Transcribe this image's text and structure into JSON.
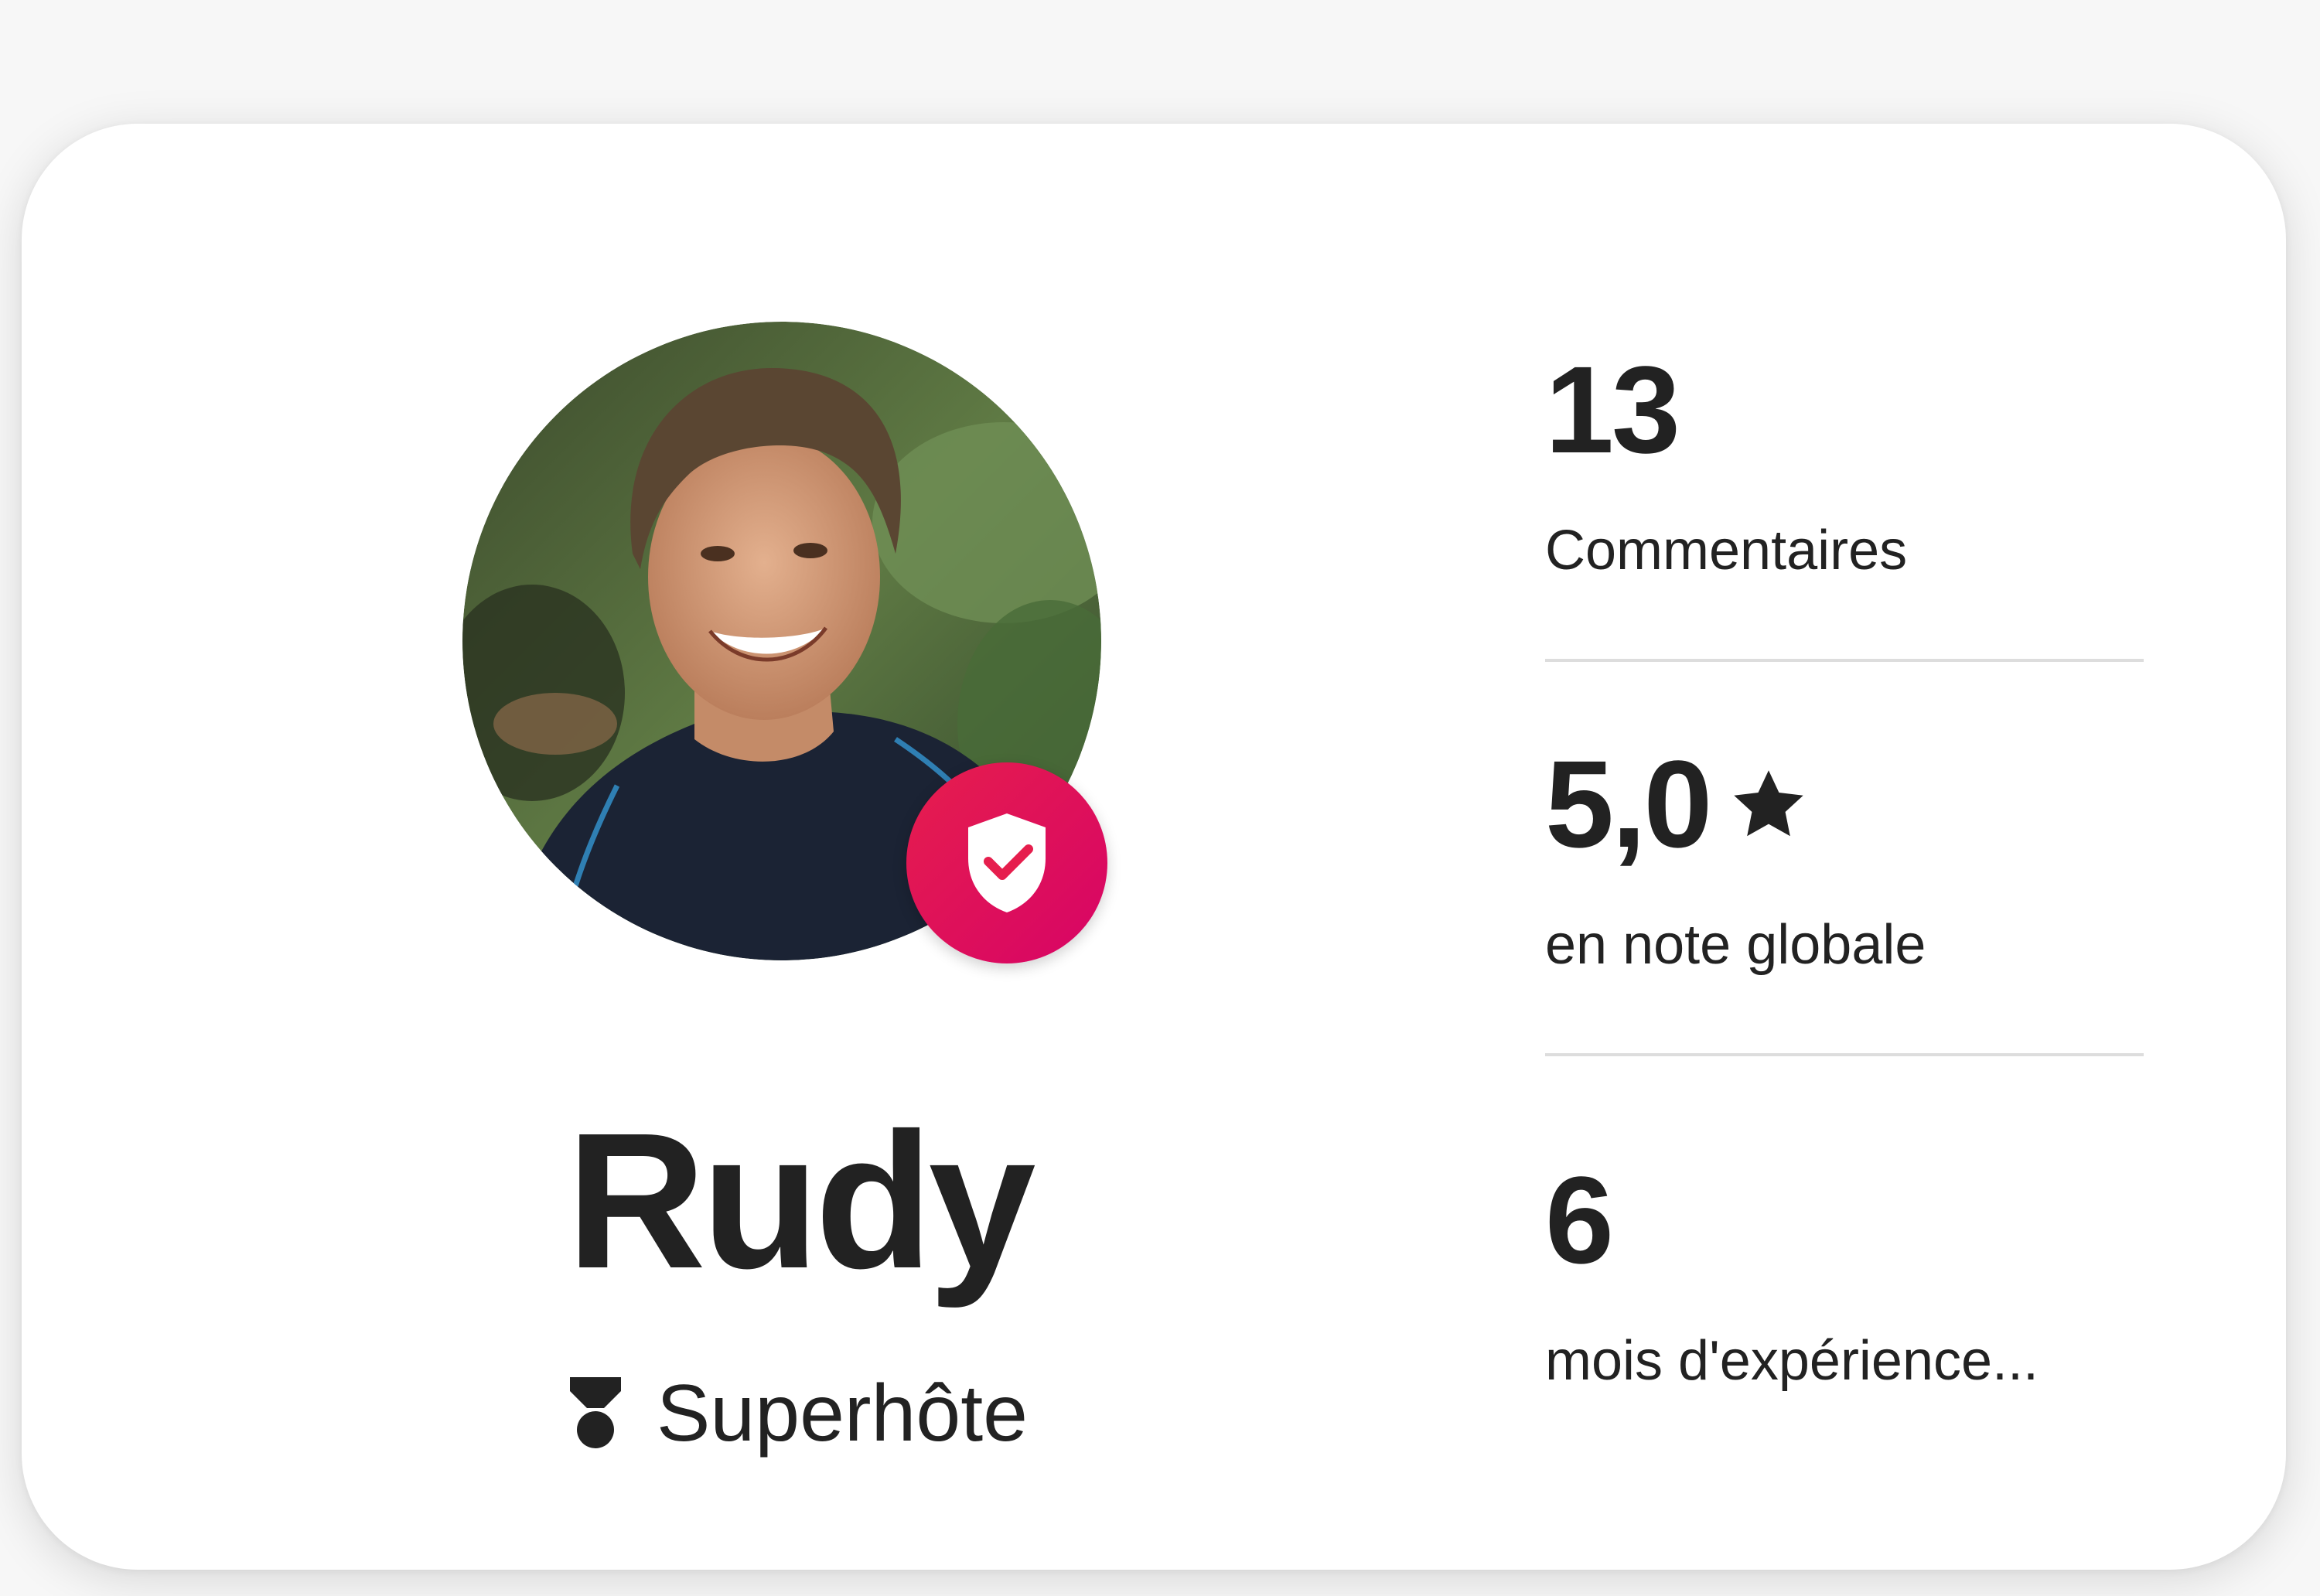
{
  "host": {
    "name": "Rudy",
    "status": "Superhôte"
  },
  "stats": [
    {
      "value": "13",
      "label": "Commentaires"
    },
    {
      "value": "5,0",
      "label": "en note globale"
    },
    {
      "value": "6",
      "label": "mois d'expérience..."
    }
  ],
  "colors": {
    "badge": "#E61E4D",
    "text": "#222222",
    "divider": "#DDDDDD"
  },
  "icons": {
    "verified": "verified-shield-icon",
    "superhost": "superhost-medal-icon",
    "rating": "star-icon"
  }
}
